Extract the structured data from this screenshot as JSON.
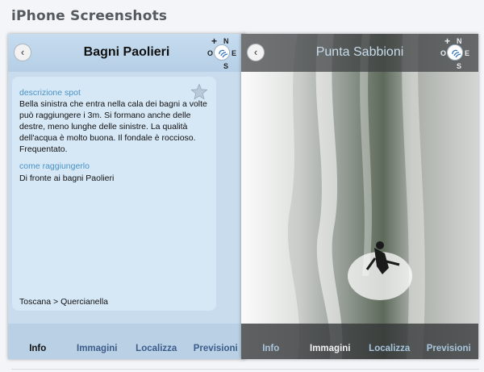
{
  "page": {
    "heading": "iPhone Screenshots"
  },
  "compass": {
    "plus": "+",
    "n": "N",
    "o": "O",
    "e": "E",
    "s": "S"
  },
  "screen1": {
    "back": "‹",
    "title": "Bagni Paolieri",
    "description_label": "descrizione spot",
    "description_text": "Bella sinistra che entra nella cala dei bagni a volte può raggiungere i 3m. Si formano anche delle destre, meno lunghe delle sinistre. La qualità dell'acqua è molto buona. Il fondale è roccioso. Frequentato.",
    "directions_label": "come raggiungerlo",
    "directions_text": "Di fronte ai bagni Paolieri",
    "location": "Toscana > Quercianella",
    "tabs": [
      "Info",
      "Immagini",
      "Localizza",
      "Previsioni"
    ],
    "active_tab": "Info"
  },
  "screen2": {
    "back": "‹",
    "title": "Punta Sabbioni",
    "tabs": [
      "Info",
      "Immagini",
      "Localizza",
      "Previsioni"
    ],
    "active_tab": "Immagini"
  },
  "colors": {
    "accent_label": "#4a93c6",
    "panel_bg": "#c8dced",
    "card_bg": "#d6e7f5"
  }
}
